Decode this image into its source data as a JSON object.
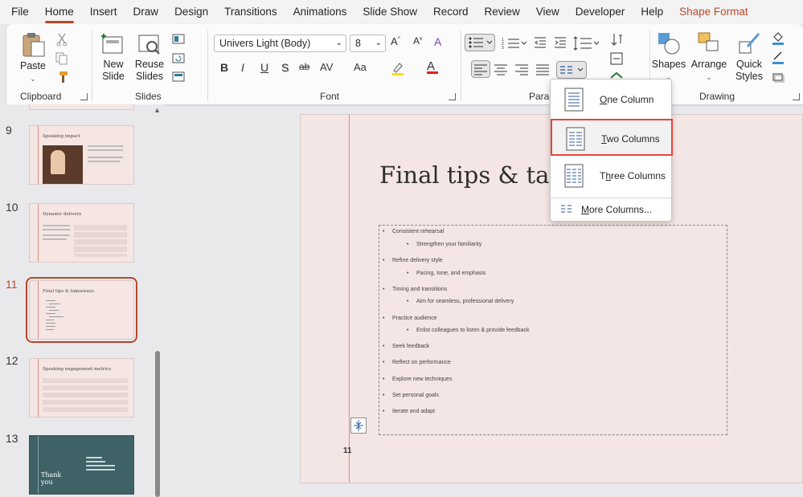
{
  "menu": {
    "items": [
      "File",
      "Home",
      "Insert",
      "Draw",
      "Design",
      "Transitions",
      "Animations",
      "Slide Show",
      "Record",
      "Review",
      "View",
      "Developer",
      "Help",
      "Shape Format"
    ]
  },
  "ribbon": {
    "clipboard": {
      "label": "Clipboard",
      "paste": "Paste"
    },
    "slides": {
      "label": "Slides",
      "new_slide_1": "New",
      "new_slide_2": "Slide",
      "reuse_1": "Reuse",
      "reuse_2": "Slides"
    },
    "font": {
      "label": "Font",
      "font_name": "Univers Light (Body)",
      "font_size": "8",
      "bold": "B",
      "italic": "I",
      "underline": "U",
      "shadow": "S",
      "strike": "ab",
      "spacing": "AV",
      "case": "Aa"
    },
    "paragraph": {
      "label": "Paragr"
    },
    "drawing": {
      "label": "Drawing",
      "shapes": "Shapes",
      "arrange": "Arrange",
      "quick_styles_1": "Quick",
      "quick_styles_2": "Styles"
    }
  },
  "thumbnails": [
    {
      "num": "9",
      "title": "Speaking impact"
    },
    {
      "num": "10",
      "title": "Dynamic delivery"
    },
    {
      "num": "11",
      "title": "Final tips & takeaways"
    },
    {
      "num": "12",
      "title": "Speaking engagement metrics"
    },
    {
      "num": "13",
      "title": "Thank you"
    }
  ],
  "slide": {
    "title": "Final tips & take",
    "number": "11",
    "bullets": [
      {
        "text": "Consistent rehearsal",
        "level": 1
      },
      {
        "text": "Strengthen your familiarity",
        "level": 2
      },
      {
        "text": "Refine delivery style",
        "level": 1
      },
      {
        "text": "Pacing, tone, and emphasis",
        "level": 2
      },
      {
        "text": "Timing and transitions",
        "level": 1
      },
      {
        "text": "Aim for seamless, professional delivery",
        "level": 2
      },
      {
        "text": "Practice audience",
        "level": 1
      },
      {
        "text": "Enlist colleagues to listen & provide feedback",
        "level": 2
      },
      {
        "text": "Seek feedback",
        "level": 1
      },
      {
        "text": "Reflect on performance",
        "level": 1
      },
      {
        "text": "Explore new techniques",
        "level": 1
      },
      {
        "text": "Set personal goals",
        "level": 1
      },
      {
        "text": "Iterate and adapt",
        "level": 1
      }
    ]
  },
  "columns_menu": {
    "one": {
      "key": "O",
      "rest": "ne Column"
    },
    "two": {
      "key": "T",
      "rest": "wo Columns"
    },
    "three_pre": "T",
    "three_key": "h",
    "three_rest": "ree Columns",
    "more_key": "M",
    "more_rest": "ore Columns..."
  },
  "colors": {
    "accent": "#b7472a",
    "highlight_border": "#e5453b",
    "slide_bg": "#f4e6e4",
    "dark_thumb": "#3f6267"
  }
}
